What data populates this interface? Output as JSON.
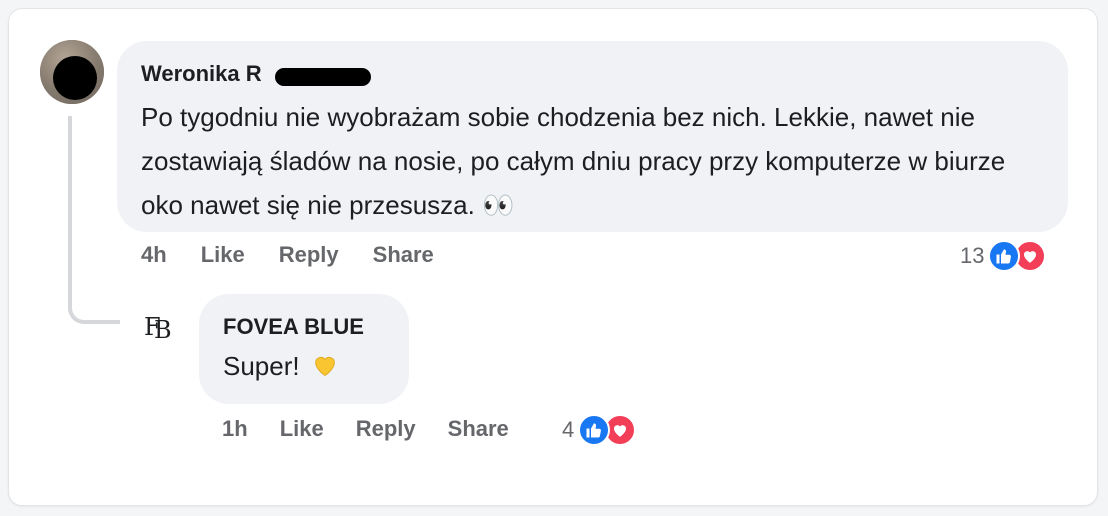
{
  "comment": {
    "author": "Weronika R",
    "text": "Po tygodniu nie wyobrażam sobie chodzenia bez nich. Lekkie, nawet nie zostawiają śladów na nosie, po całym dniu pracy przy komputerze w biurze oko nawet się nie przesusza. 👀",
    "time": "4h",
    "like_label": "Like",
    "reply_label": "Reply",
    "share_label": "Share",
    "reaction_count": "13",
    "reactions": [
      "like-icon",
      "love-icon"
    ]
  },
  "reply": {
    "author": "FOVEA BLUE",
    "text": "Super!",
    "emoji": "yellow-heart-icon",
    "time": "1h",
    "like_label": "Like",
    "reply_label": "Reply",
    "share_label": "Share",
    "reaction_count": "4",
    "reactions": [
      "like-icon",
      "love-icon"
    ]
  },
  "colors": {
    "like": "#1877f2",
    "love": "#f33e58",
    "bubble": "#f0f2f5",
    "secondary_text": "#65676b"
  }
}
